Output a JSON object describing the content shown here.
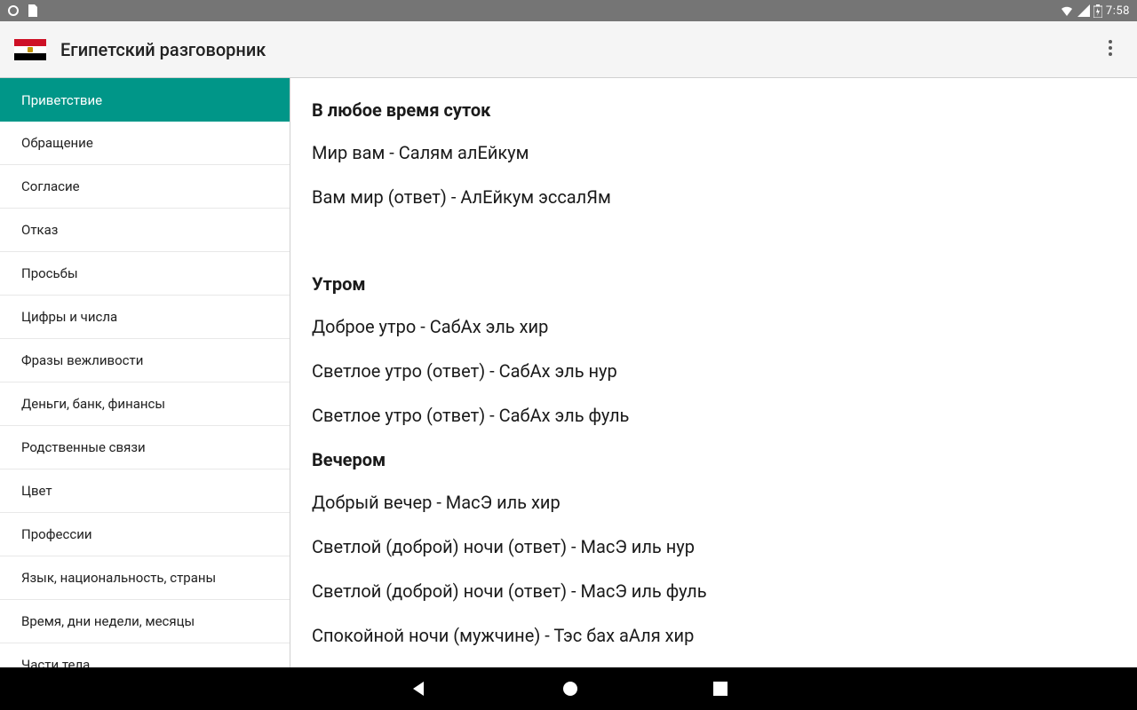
{
  "status": {
    "clock": "7:58"
  },
  "app": {
    "title": "Египетский разговорник"
  },
  "sidebar": {
    "items": [
      "Приветствие",
      "Обращение",
      "Согласие",
      "Отказ",
      "Просьбы",
      "Цифры и числа",
      "Фразы вежливости",
      "Деньги, банк, финансы",
      "Родственные связи",
      "Цвет",
      "Профессии",
      "Язык, национальность, страны",
      "Время, дни недели, месяцы",
      "Части тела"
    ],
    "active_index": 0
  },
  "content": {
    "sections": [
      {
        "title": "В любое время суток",
        "phrases": [
          "Мир вам - Салям алЕйкум",
          "Вам мир (ответ) - АлЕйкум эссалЯм"
        ]
      },
      {
        "title": "Утром",
        "phrases": [
          "Доброе утро - СабАх эль хир",
          "Светлое утро (ответ) - СабАх эль нур",
          "Светлое утро (ответ) - СабАх эль фуль"
        ]
      },
      {
        "title": "Вечером",
        "phrases": [
          "Добрый вечер - МасЭ иль хир",
          "Светлой (доброй) ночи (ответ) - МасЭ иль нур",
          "Светлой (доброй) ночи (ответ) - МасЭ иль фуль",
          "Спокойной ночи (мужчине) - Тэс бах аАля хир"
        ]
      }
    ]
  }
}
